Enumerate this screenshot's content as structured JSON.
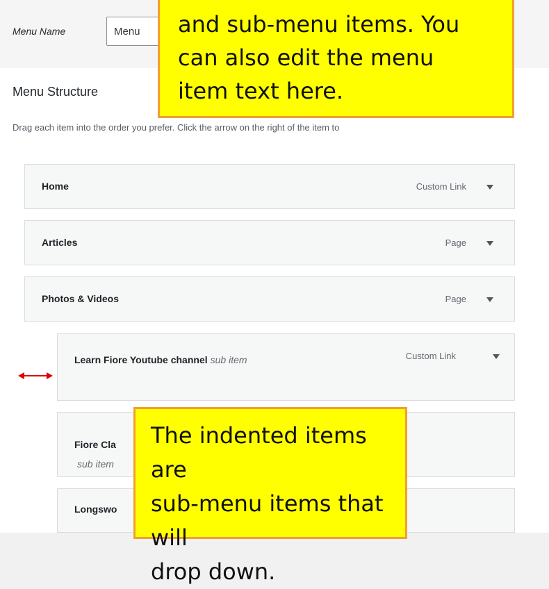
{
  "menu_name": {
    "label": "Menu Name",
    "value": "Menu"
  },
  "structure": {
    "title": "Menu Structure",
    "description": "Drag each item into the order you prefer. Click the arrow on the right of the item to"
  },
  "items": [
    {
      "title": "Home",
      "sub_label": "",
      "type": "Custom Link"
    },
    {
      "title": "Articles",
      "sub_label": "",
      "type": "Page"
    },
    {
      "title": "Photos & Videos",
      "sub_label": "",
      "type": "Page"
    },
    {
      "title": "Learn Fiore Youtube channel",
      "sub_label": "sub item",
      "type": "Custom Link"
    },
    {
      "title": "Fiore Cla",
      "sub_label": "sub item",
      "type": ""
    },
    {
      "title": "Longswo",
      "sub_label": "",
      "type": ""
    }
  ],
  "callouts": {
    "top": {
      "line1": "and sub-menu items. You",
      "line2": "can also edit the menu",
      "line3": "item text here."
    },
    "bottom": {
      "line1": "The indented items are",
      "line2": "sub-menu items that will",
      "line3": "drop down."
    }
  },
  "colors": {
    "callout_fill": "#ffff00",
    "callout_border": "#f0a030",
    "indent_arrow": "#e00000"
  },
  "icons": {
    "item_toggle": "triangle-down-icon",
    "indent_marker": "double-arrow-horizontal-icon"
  }
}
